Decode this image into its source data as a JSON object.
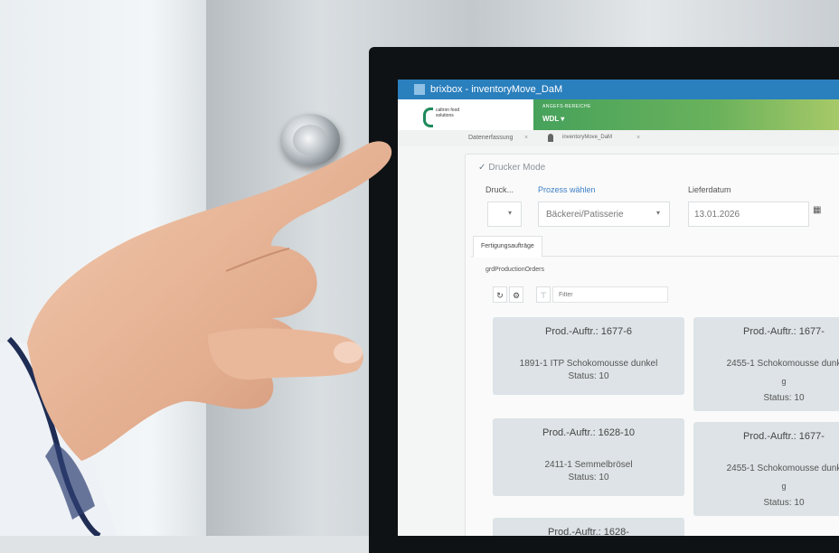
{
  "window": {
    "title": "brixbox - inventoryMove_DaM"
  },
  "header": {
    "logo_text": "caltron food solutions",
    "site_label": "ANGEFS-BEREICHE",
    "site_value": "WDL ▾"
  },
  "breadcrumb": {
    "crumb1": "Datenerfassung",
    "crumb2": "inventoryMove_DaM",
    "close_glyph": "×"
  },
  "form": {
    "mode_label": "Drucker Mode",
    "druck_label": "Druck...",
    "prozess_label": "Prozess wählen",
    "prozess_value": "Bäckerei/Patisserie",
    "liefer_label": "Lieferdatum",
    "liefer_value": "13.01.2026"
  },
  "tabs": [
    {
      "label": "Fertigungsaufträge"
    }
  ],
  "grid": {
    "label": "grdProductionOrders",
    "filter_placeholder": "Filter"
  },
  "cards": [
    {
      "title": "Prod.-Auftr.: 1677-6",
      "desc": "1891-1 ITP Schokomousse dunkel",
      "extra": "",
      "status": "Status: 10"
    },
    {
      "title": "Prod.-Auftr.: 1677-",
      "desc": "2455-1 Schokomousse dunk",
      "extra": "g",
      "status": "Status: 10"
    },
    {
      "title": "Prod.-Auftr.: 1628-10",
      "desc": "2411-1 Semmelbrösel",
      "extra": "",
      "status": "Status: 10"
    },
    {
      "title": "Prod.-Auftr.: 1677-",
      "desc": "2455-1 Schokomousse dunk",
      "extra": "g",
      "status": "Status: 10"
    },
    {
      "title": "Prod.-Auftr.: 1628-",
      "desc": "",
      "extra": "",
      "status": ""
    }
  ],
  "icons": {
    "check": "✓",
    "chevron": "▾",
    "calendar": "▦",
    "refresh": "↻",
    "gear": "⚙",
    "filter": "⊤"
  }
}
